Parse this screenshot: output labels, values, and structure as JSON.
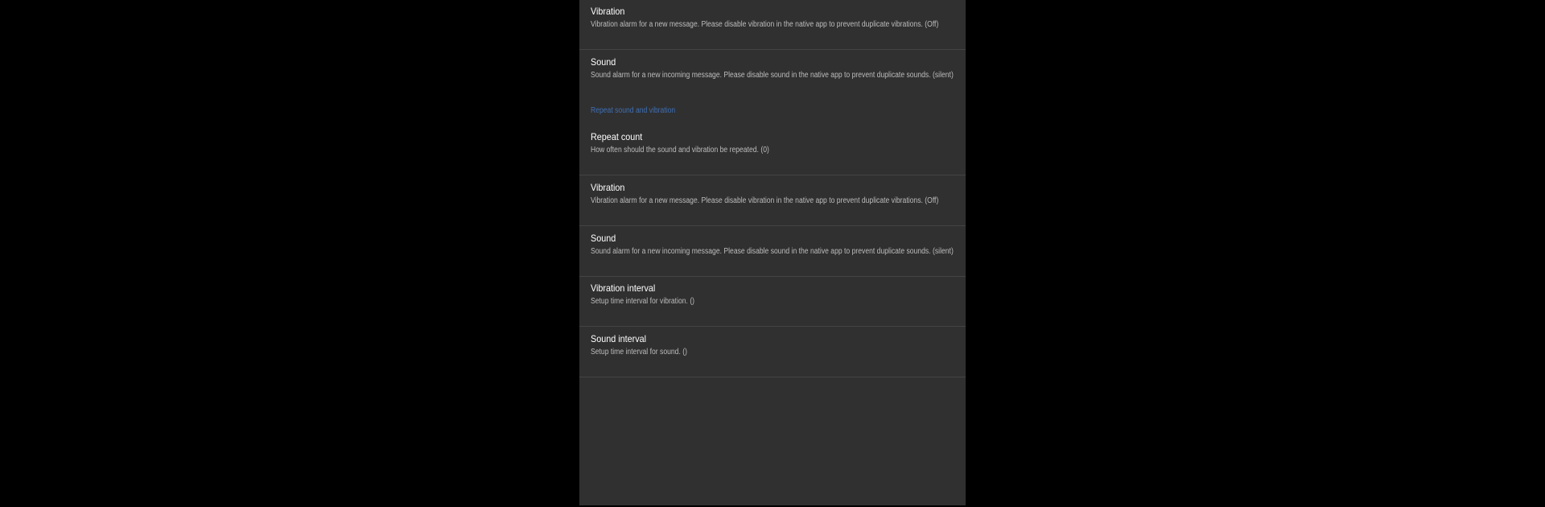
{
  "colors": {
    "background": "#000000",
    "panel": "#303030",
    "divider": "#444444",
    "title_text": "#ffffff",
    "summary_text": "#bdbdbd",
    "category_accent": "#3f6fb5"
  },
  "preferences_top": [
    {
      "title": "Vibration",
      "summary": "Vibration alarm for a new message. Please disable vibration in the native app to prevent duplicate vibrations. (Off)"
    },
    {
      "title": "Sound",
      "summary": "Sound alarm for a new incoming message. Please disable sound in the native app to prevent duplicate sounds. (silent)"
    }
  ],
  "repeat_section": {
    "category_title": "Repeat sound and vibration",
    "items": [
      {
        "title": "Repeat count",
        "summary": "How often should the sound and vibration be repeated. (0)"
      },
      {
        "title": "Vibration",
        "summary": "Vibration alarm for a new message. Please disable vibration in the native app to prevent duplicate vibrations. (Off)"
      },
      {
        "title": "Sound",
        "summary": "Sound alarm for a new incoming message. Please disable sound in the native app to prevent duplicate sounds. (silent)"
      },
      {
        "title": "Vibration interval",
        "summary": "Setup time interval for vibration. ()"
      },
      {
        "title": "Sound interval",
        "summary": "Setup time interval for sound. ()"
      }
    ]
  }
}
